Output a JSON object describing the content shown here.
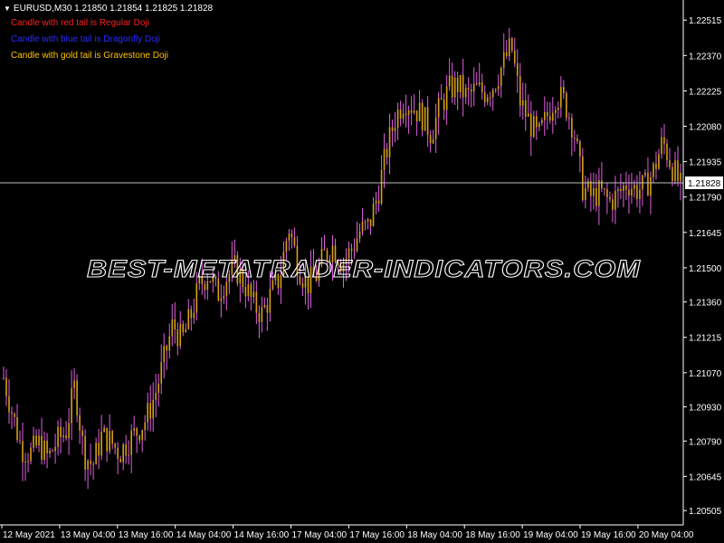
{
  "header": {
    "symbol_line": "EURUSD,M30  1.21850 1.21854 1.21825 1.21828"
  },
  "legend": [
    {
      "text": "Candle with red tail is Regular Doji",
      "color": "#ff2020"
    },
    {
      "text": "Candle with blue tail is Dragonfly Doji",
      "color": "#2a2aff"
    },
    {
      "text": "Candle with gold tail is Gravestone Doji",
      "color": "#ffc400"
    }
  ],
  "watermark": "BEST-METATRADER-INDICATORS.COM",
  "colors": {
    "background": "#000000",
    "candle_body": "#d4a017",
    "candle_tail": "#e060e0",
    "axis": "#ffffff",
    "price_line": "#c0c0c0"
  },
  "current_price_label": "1.21828",
  "chart_data": {
    "type": "candlestick",
    "symbol": "EURUSD",
    "timeframe": "M30",
    "ohlc": {
      "open": 1.2185,
      "high": 1.21854,
      "low": 1.21825,
      "close": 1.21828
    },
    "current_price": 1.21828,
    "ylim": [
      1.2045,
      1.2259
    ],
    "y_ticks": [
      "1.22515",
      "1.22370",
      "1.22225",
      "1.22080",
      "1.21935",
      "1.21790",
      "1.21645",
      "1.21500",
      "1.21360",
      "1.21215",
      "1.21070",
      "1.20930",
      "1.20790",
      "1.20645",
      "1.20505"
    ],
    "x_ticks": [
      "12 May 2021",
      "13 May 04:00",
      "13 May 16:00",
      "14 May 04:00",
      "14 May 16:00",
      "17 May 04:00",
      "17 May 16:00",
      "18 May 04:00",
      "18 May 16:00",
      "19 May 04:00",
      "19 May 16:00",
      "20 May 04:00"
    ],
    "close_path": [
      1.2105,
      1.209,
      1.2076,
      1.2074,
      1.2078,
      1.2072,
      1.2079,
      1.2083,
      1.2102,
      1.2074,
      1.2069,
      1.2081,
      1.2079,
      1.2074,
      1.2079,
      1.2083,
      1.2088,
      1.2098,
      1.2112,
      1.2127,
      1.212,
      1.213,
      1.2143,
      1.2148,
      1.2139,
      1.2146,
      1.215,
      1.2144,
      1.2135,
      1.2131,
      1.2139,
      1.2146,
      1.2167,
      1.2152,
      1.2143,
      1.2146,
      1.2155,
      1.2159,
      1.2152,
      1.2157,
      1.2165,
      1.2167,
      1.218,
      1.2198,
      1.2212,
      1.2219,
      1.2216,
      1.2212,
      1.2205,
      1.2216,
      1.2223,
      1.2225,
      1.222,
      1.2223,
      1.2222,
      1.2225,
      1.2233,
      1.2241,
      1.2218,
      1.221,
      1.2203,
      1.2212,
      1.2221,
      1.2218,
      1.2207,
      1.2183,
      1.2179,
      1.2181,
      1.2177,
      1.218,
      1.2185,
      1.2182,
      1.2183,
      1.219,
      1.2202,
      1.2192,
      1.2183
    ]
  }
}
